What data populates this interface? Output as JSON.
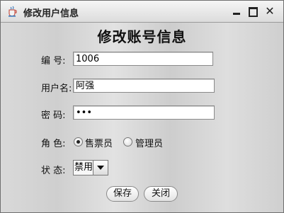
{
  "window": {
    "title": "修改用户信息",
    "minimize_label": "",
    "maximize_label": "",
    "close_label": "✕"
  },
  "form": {
    "heading": "修改账号信息",
    "id_label": "编  号:",
    "id_value": "1006",
    "username_label": "用户名:",
    "username_value": "阿强",
    "password_label": "密  码:",
    "password_value": "•••",
    "role_label": "角  色:",
    "role_options": [
      "售票员",
      "管理员"
    ],
    "role_selected": "售票员",
    "status_label": "状  态:",
    "status_value": "禁用"
  },
  "buttons": {
    "save": "保存",
    "close": "关闭"
  },
  "icons": {
    "app": "java-cup-icon",
    "minimize": "minimize-icon",
    "maximize": "maximize-icon",
    "close": "close-icon"
  }
}
